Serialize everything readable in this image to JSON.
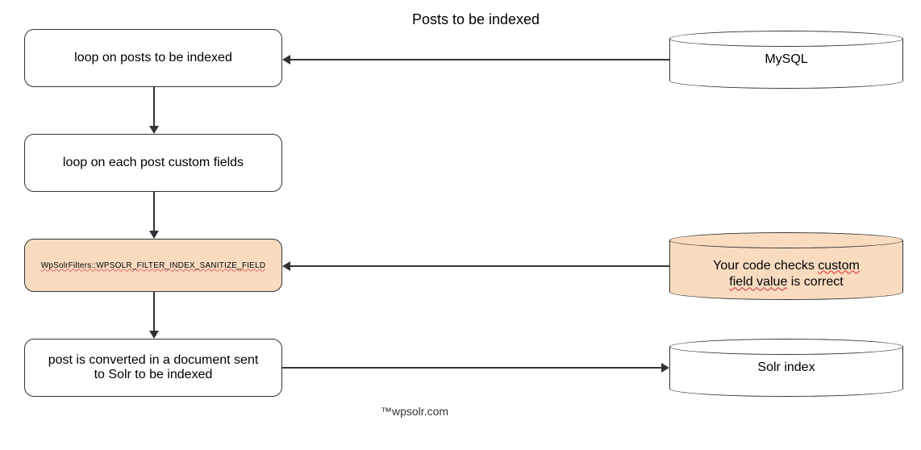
{
  "boxes": {
    "loop_posts": "loop on posts to be indexed",
    "loop_fields": "loop on each post custom fields",
    "filter": "WpSolrFilters::WPSOLR_FILTER_INDEX_SANITIZE_FIELD",
    "convert": "post is converted in a document sent\nto Solr to be indexed"
  },
  "cylinders": {
    "mysql": "MySQL",
    "check_a": "Your code checks ",
    "check_b": "custom\nfield value",
    "check_c": " is correct",
    "solr": "Solr index"
  },
  "edges": {
    "posts_to_index": "Posts to be indexed"
  },
  "footer": "™wpsolr.com"
}
